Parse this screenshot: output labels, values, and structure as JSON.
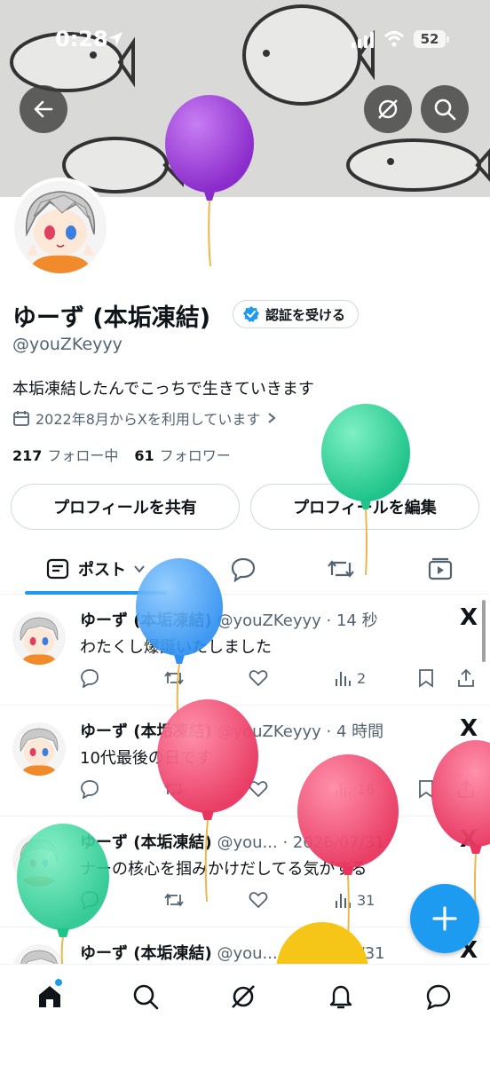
{
  "status_bar": {
    "time": "0:28",
    "battery": "52"
  },
  "profile": {
    "name": "ゆーず (本垢凍結)",
    "verify_label": "認証を受ける",
    "handle": "@youZKeyyy",
    "bio": "本垢凍結したんでこっちで生きていきます",
    "joined": "2022年8月からXを利用しています",
    "following_count": "217",
    "following_label": "フォロー中",
    "followers_count": "61",
    "followers_label": "フォロワー",
    "share_label": "プロフィールを共有",
    "edit_label": "プロフィールを編集"
  },
  "tabs": {
    "posts_label": "ポスト"
  },
  "posts": [
    {
      "name": "ゆーず (本垢凍結)",
      "handle": "@youZKeyyy",
      "time": "14 秒",
      "text": "わたくし爆誕いたしました",
      "views": "2"
    },
    {
      "name": "ゆーず (本垢凍結)",
      "handle": "@youZKeyyy",
      "time": "4 時間",
      "text": "10代最後の日です",
      "views": "16"
    },
    {
      "name": "ゆーず (本垢凍結)",
      "handle": "@you...",
      "time": "2026/07/31",
      "text": "ナーの核心を掴みかけだしてる気がする",
      "views": "31"
    },
    {
      "name": "ゆーず (本垢凍結)",
      "handle": "@you...",
      "time": "2026/07/31"
    }
  ],
  "x_logo": "X",
  "colors": {
    "accent": "#1d9bf0",
    "balloon_purple": "#9b3fd8",
    "balloon_green": "#2ed39a",
    "balloon_blue": "#3aa2f4",
    "balloon_pink": "#f0476f",
    "balloon_yellow": "#f5c518"
  },
  "icons": [
    "back-arrow-icon",
    "grok-icon",
    "search-icon",
    "verified-badge-icon",
    "calendar-icon",
    "chevron-right-icon",
    "article-icon",
    "chevron-down-icon",
    "reply-icon",
    "repost-icon",
    "like-icon",
    "views-icon",
    "bookmark-icon",
    "share-icon",
    "home-icon",
    "bell-icon",
    "messages-icon",
    "plus-icon"
  ]
}
